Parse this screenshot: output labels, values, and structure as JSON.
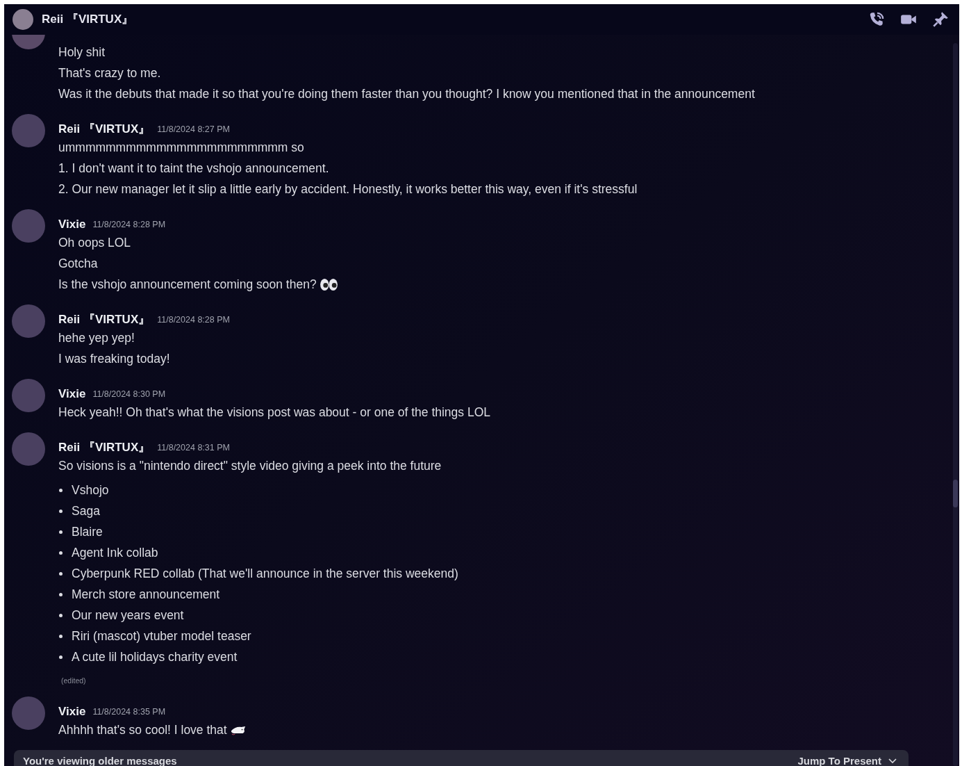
{
  "header": {
    "title": "Reii 『VIRTUX』"
  },
  "messages": [
    {
      "lines": [
        {
          "kind": "text",
          "text": "Holy shit"
        },
        {
          "kind": "text",
          "text": "That's crazy to me."
        },
        {
          "kind": "text",
          "text": "Was it the debuts that made it so that you're doing them faster than you thought? I know you mentioned that in the announcement"
        }
      ]
    },
    {
      "author": "Reii 『VIRTUX』",
      "timestamp": "11/8/2024 8:27 PM",
      "lines": [
        {
          "kind": "text",
          "text": "ummmmmmmmmmmmmmmmmmmmmm so"
        },
        {
          "kind": "text",
          "text": "1. I don't want it to taint the vshojo announcement."
        },
        {
          "kind": "text",
          "text": "2. Our new manager let it slip a little early by accident. Honestly, it works better this way, even if it's stressful"
        }
      ]
    },
    {
      "author": "Vixie",
      "timestamp": "11/8/2024 8:28 PM",
      "lines": [
        {
          "kind": "text",
          "text": "Oh oops LOL"
        },
        {
          "kind": "text",
          "text": "Gotcha"
        },
        {
          "kind": "text",
          "text": "Is the vshojo announcement coming soon then?",
          "emoji": {
            "kind": "eyes"
          }
        }
      ]
    },
    {
      "author": "Reii 『VIRTUX』",
      "timestamp": "11/8/2024 8:28 PM",
      "lines": [
        {
          "kind": "text",
          "text": "hehe yep yep!"
        },
        {
          "kind": "text",
          "text": "I was freaking today!"
        }
      ]
    },
    {
      "author": "Vixie",
      "timestamp": "11/8/2024 8:30 PM",
      "lines": [
        {
          "kind": "text",
          "text": "Heck yeah!! Oh that's what the visions post was about - or one of the things LOL"
        }
      ]
    },
    {
      "author": "Reii 『VIRTUX』",
      "timestamp": "11/8/2024 8:31 PM",
      "edited": "(edited)",
      "lines": [
        {
          "kind": "text",
          "text": "So visions is a \"nintendo direct\" style video giving a peek into the future"
        },
        {
          "kind": "list",
          "items": [
            "Vshojo",
            "Saga",
            "Blaire",
            "Agent Ink collab",
            "Cyberpunk RED collab (That we'll announce in the server this weekend)",
            "Merch store announcement",
            "Our new years event",
            "Riri (mascot) vtuber model teaser",
            "A cute lil holidays charity event"
          ]
        }
      ]
    },
    {
      "author": "Vixie",
      "timestamp": "11/8/2024 8:35 PM",
      "lines": [
        {
          "kind": "text",
          "text": "Ahhhh that's so cool! I love that",
          "emoji": {
            "kind": "creature"
          }
        }
      ]
    }
  ],
  "older_bar": {
    "label": "You're viewing older messages",
    "action": "Jump To Present"
  }
}
